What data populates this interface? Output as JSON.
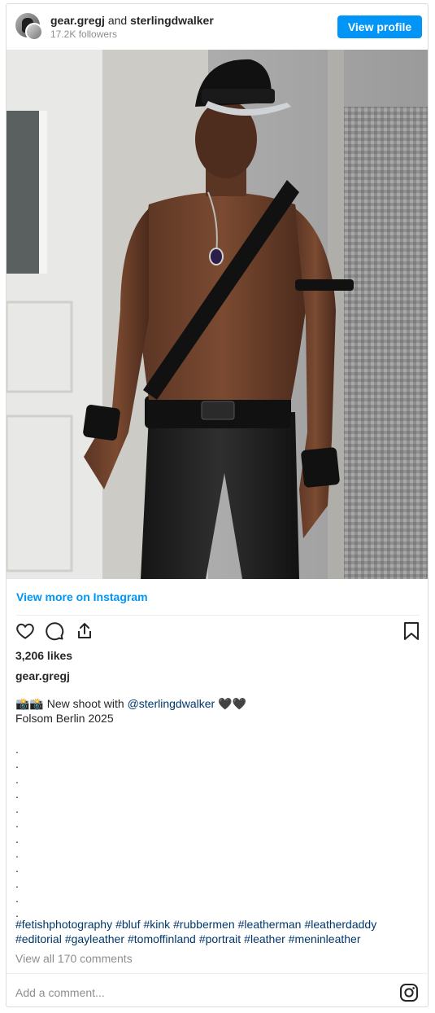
{
  "header": {
    "username": "gear.gregj",
    "connector": "and",
    "collaborator": "sterlingdwalker",
    "followers": "17.2K followers",
    "view_profile_label": "View profile"
  },
  "post": {
    "view_more_label": "View more on Instagram",
    "likes": "3,206 likes",
    "owner": "gear.gregj",
    "caption_prefix": "📸📸 New shoot with ",
    "caption_mention": "@sterlingdwalker",
    "caption_suffix": " 🖤🖤",
    "caption_line2": "Folsom Berlin 2025",
    "dots": [
      ".",
      ".",
      ".",
      ".",
      ".",
      ".",
      ".",
      ".",
      ".",
      ".",
      ".",
      "."
    ],
    "hashtags": [
      "#fetishphotography",
      "#bluf",
      "#kink",
      "#rubbermen",
      "#leatherman",
      "#leatherdaddy",
      "#editorial",
      "#gayleather",
      "#tomoffinland",
      "#portrait",
      "#leather",
      "#meninleather"
    ],
    "view_comments": "View all 170 comments",
    "add_comment_placeholder": "Add a comment..."
  },
  "colors": {
    "accent": "#0095f6",
    "link": "#00376b",
    "muted": "#8e8e8e",
    "border": "#dbdbdb"
  },
  "icons": [
    "heart-icon",
    "comment-icon",
    "share-icon",
    "bookmark-icon",
    "instagram-icon"
  ]
}
